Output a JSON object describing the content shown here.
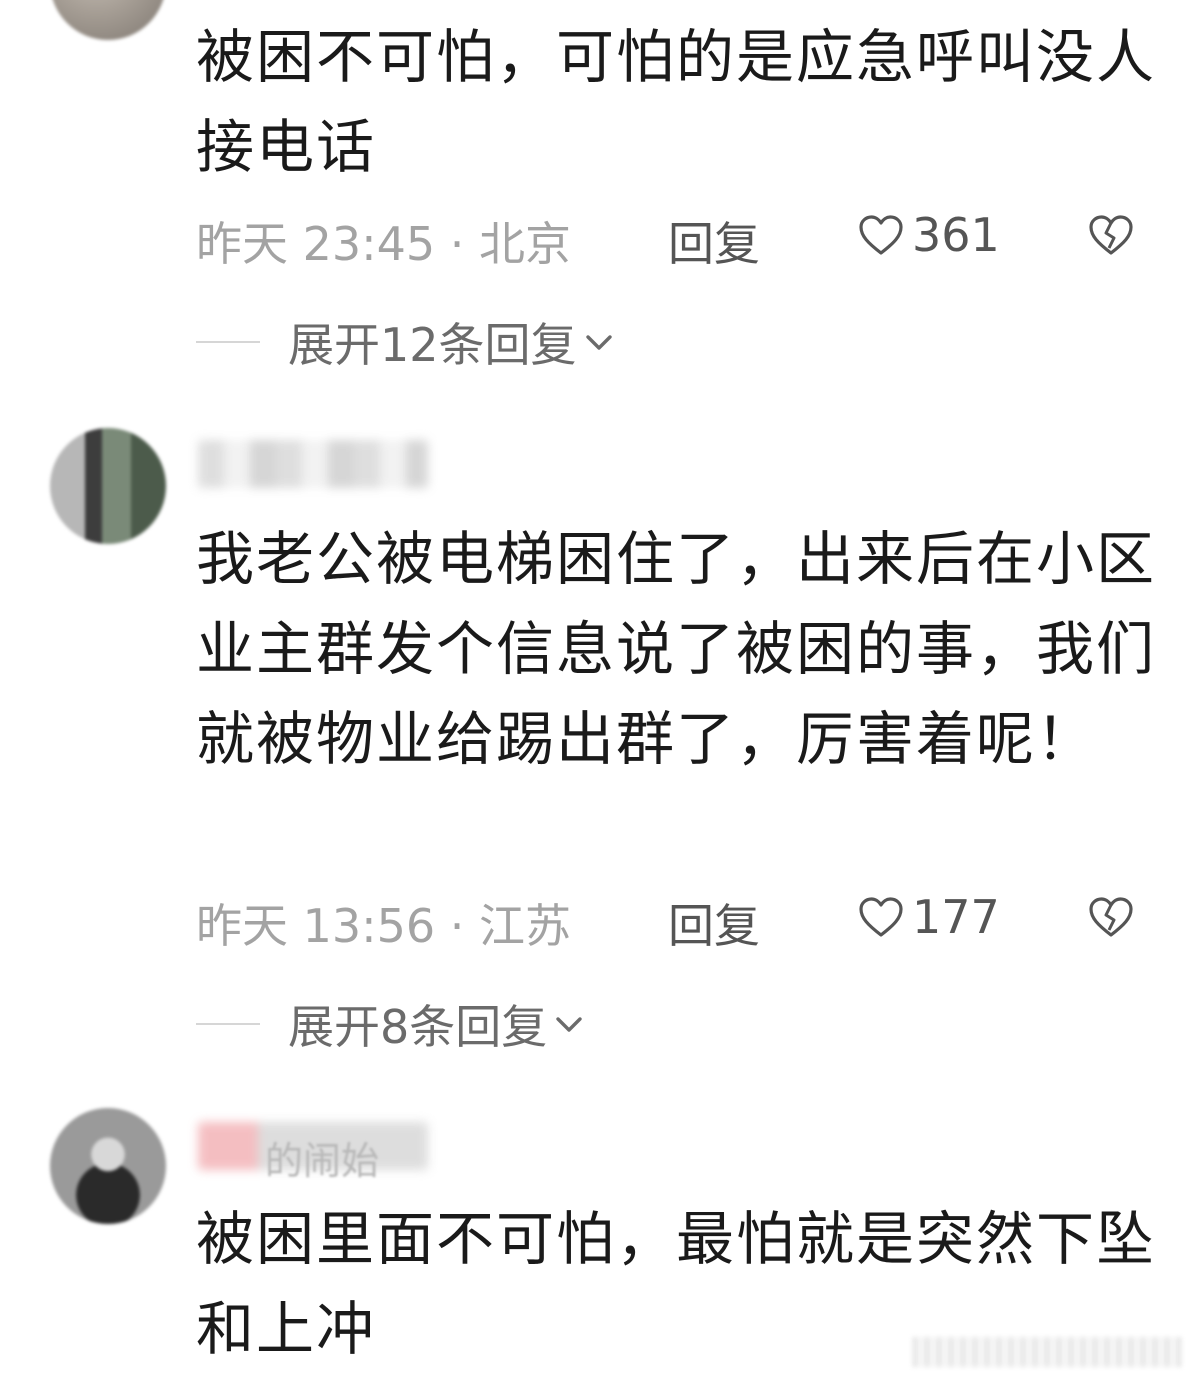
{
  "comments": [
    {
      "text": "被困不可怕，可怕的是应急呼叫没人接电话",
      "meta": "昨天 23:45 · 北京",
      "reply_label": "回复",
      "like_count": "361",
      "expand_label": "展开12条回复"
    },
    {
      "text": "我老公被电梯困住了，出来后在小区业主群发个信息说了被困的事，我们就被物业给踢出群了，厉害着呢！",
      "meta": "昨天 13:56 · 江苏",
      "reply_label": "回复",
      "like_count": "177",
      "expand_label": "展开8条回复"
    },
    {
      "username_fragment": "的闹始",
      "text": "被困里面不可怕，最怕就是突然下坠和上冲"
    }
  ],
  "icons": {
    "like": "heart-outline-icon",
    "dislike": "broken-heart-icon",
    "expand": "chevron-down-icon"
  },
  "colors": {
    "text": "#1a1a1a",
    "meta": "#a3a3a3",
    "action": "#555555"
  }
}
